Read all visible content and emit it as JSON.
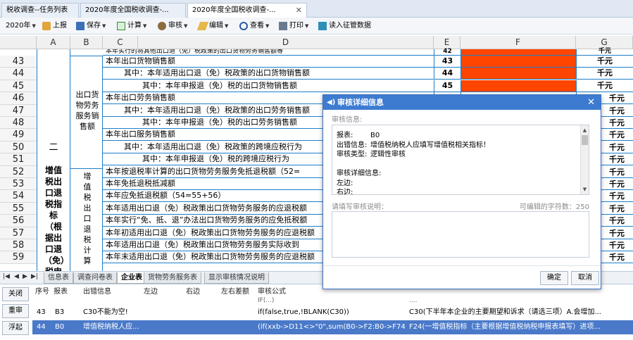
{
  "tabs": [
    {
      "label": "税收调查--任务列表",
      "active": false
    },
    {
      "label": "2020年度全国税收调查-...",
      "active": false
    },
    {
      "label": "2020年度全国税收调查-...",
      "active": true
    }
  ],
  "toolbar": {
    "year": "2020年",
    "report": "上报",
    "save": "保存",
    "calc": "计算",
    "audit": "审核",
    "edit": "编辑",
    "view": "查看",
    "print": "打印",
    "import": "读入征管数据"
  },
  "columns": [
    "A",
    "B",
    "C",
    "D",
    "E",
    "F",
    "G"
  ],
  "grid": {
    "top_partial_text": "本年实行的将其他出口退（免）税政策的出口货物劳务销售额等",
    "top_partial_unit": "千元",
    "top_partial_code": "42",
    "section_num": "二",
    "section_title": "增值税出口退税指标（根据出口退（免）税申",
    "group1": "出口货物劳务服务销售额",
    "group2": "增值税出口退税计算",
    "rows": [
      {
        "num": "43",
        "text": "本年出口货物销售额",
        "code": "43",
        "unit": "千元",
        "indent": 0
      },
      {
        "num": "44",
        "text": "其中：本年适用出口退（免）税政策的出口货物销售额",
        "code": "44",
        "unit": "千元",
        "indent": 1
      },
      {
        "num": "45",
        "text": "其中：本年申报退（免）税的出口货物销售额",
        "code": "45",
        "unit": "千元",
        "indent": 2
      },
      {
        "num": "46",
        "text": "本年出口劳务销售额",
        "code": "",
        "unit": "",
        "indent": 0
      },
      {
        "num": "47",
        "text": "其中：本年适用出口退（免）税政策的出口劳务销售额",
        "code": "",
        "unit": "",
        "indent": 1
      },
      {
        "num": "48",
        "text": "其中：本年申报退（免）税的出口劳务销售额",
        "code": "",
        "unit": "",
        "indent": 2
      },
      {
        "num": "49",
        "text": "本年出口服务销售额",
        "code": "",
        "unit": "",
        "indent": 0
      },
      {
        "num": "50",
        "text": "其中：本年适用出口退（免）税政策的跨境应税行为",
        "code": "",
        "unit": "",
        "indent": 1
      },
      {
        "num": "51",
        "text": "其中：本年申报退（免）税的跨境应税行为",
        "code": "",
        "unit": "",
        "indent": 2
      },
      {
        "num": "52",
        "text": "本年按退税率计算的出口货物劳务服务免抵退税额（52=",
        "code": "",
        "unit": "",
        "indent": 0
      },
      {
        "num": "53",
        "text": "本年免抵退税抵减额",
        "code": "",
        "unit": "",
        "indent": 0
      },
      {
        "num": "54",
        "text": "本年应免抵退税额（54=55+56）",
        "code": "",
        "unit": "",
        "indent": 0
      },
      {
        "num": "55",
        "text": "本年适用出口退（免）税政策出口货物劳务服务的应退税额",
        "code": "",
        "unit": "",
        "indent": 0
      },
      {
        "num": "56",
        "text": "本年实行“免、抵、退”办法出口货物劳务服务的应免抵税额",
        "code": "",
        "unit": "",
        "indent": 0
      },
      {
        "num": "57",
        "text": "本年初适用出口退（免）税政策出口货物劳务服务的应退税额",
        "code": "",
        "unit": "",
        "indent": 0
      },
      {
        "num": "58",
        "text": "本年适用出口退（免）税政策出口货物劳务服务实际收到",
        "code": "",
        "unit": "",
        "indent": 0
      },
      {
        "num": "59",
        "text": "本年末适用出口退（免）税政策出口货物劳务服务的应退税额",
        "code": "",
        "unit": "",
        "indent": 0
      }
    ],
    "right_units": [
      "千元",
      "千元",
      "千元",
      "千元",
      "千元",
      "千元",
      "千元",
      "千元",
      "千元",
      "千元",
      "千元",
      "千元",
      "千元",
      "千元"
    ]
  },
  "sheets": [
    "信息表",
    "调查问卷表",
    "企业表",
    "货物劳务服务表",
    "显示审核情况说明"
  ],
  "active_sheet": "企业表",
  "side_buttons": {
    "close": "关闭",
    "recheck": "重审",
    "float": "浮起"
  },
  "error_headers": [
    "序号",
    "报表",
    "出错信息",
    "左边",
    "右边",
    "左右差额",
    "审核公式"
  ],
  "error_rows": [
    {
      "no": "",
      "table": "",
      "msg": "",
      "formula": "IF(...)",
      "desc": "...."
    },
    {
      "no": "43",
      "table": "B3",
      "msg": "C30不能为空!",
      "formula": "if(false,true,!BLANK(C30))",
      "desc": "C30(下半年本企业的主要期望和诉求（请选三项）A.会增加..."
    },
    {
      "no": "44",
      "table": "B0",
      "msg": "增值税纳税人应...",
      "formula": "(if(xxb->D11<>\"0\",sum(B0->F2:B0->F74...",
      "desc": "F24(一增值税指标（主要根据增值税纳税申报表填写）进项..."
    }
  ],
  "dialog": {
    "title": "审核详细信息",
    "section_label": "审核信息:",
    "lines": [
      {
        "k": "报表:",
        "v": "B0"
      },
      {
        "k": "出错信息:",
        "v": "增值税纳税人应填写增值税相关指标！"
      },
      {
        "k": "审核类型:",
        "v": "逻辑性审核"
      },
      {
        "k": "",
        "v": ""
      },
      {
        "k": "审核详细信息:",
        "v": ""
      },
      {
        "k": "左边:",
        "v": ""
      },
      {
        "k": "右边:",
        "v": ""
      }
    ],
    "input_label": "请填写审核说明：",
    "counter_label": "可编辑的字符数：250",
    "ok": "确定",
    "cancel": "取消"
  },
  "colors": {
    "accent": "#3d7bd1",
    "cell_fill": "#ff4500",
    "selected_row": "#4a79c9",
    "grid_line": "#1e7ec8"
  }
}
